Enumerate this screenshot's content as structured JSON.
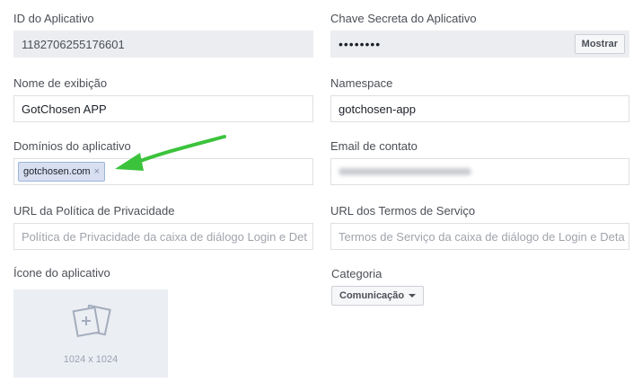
{
  "app_id": {
    "label": "ID do Aplicativo",
    "value": "1182706255176601"
  },
  "app_secret": {
    "label": "Chave Secreta do Aplicativo",
    "value": "••••••••",
    "show_button": "Mostrar"
  },
  "display_name": {
    "label": "Nome de exibição",
    "value": "GotChosen APP"
  },
  "namespace": {
    "label": "Namespace",
    "value": "gotchosen-app"
  },
  "app_domains": {
    "label": "Domínios do aplicativo",
    "tokens": [
      "gotchosen.com"
    ],
    "remove_glyph": "×"
  },
  "contact_email": {
    "label": "Email de contato"
  },
  "privacy_url": {
    "label": "URL da Política de Privacidade",
    "placeholder": "Política de Privacidade da caixa de diálogo Login e Det"
  },
  "terms_url": {
    "label": "URL dos Termos de Serviço",
    "placeholder": "Termos de Serviço da caixa de diálogo de Login e Deta"
  },
  "app_icon": {
    "label": "Ícone do aplicativo",
    "size_hint": "1024 x 1024",
    "icon": "add-image-icon"
  },
  "category": {
    "label": "Categoria",
    "value": "Comunicação"
  },
  "colors": {
    "annotation_arrow": "#3cc33c",
    "token_bg": "#d8dff0",
    "readonly_bg": "#ebedf0"
  }
}
